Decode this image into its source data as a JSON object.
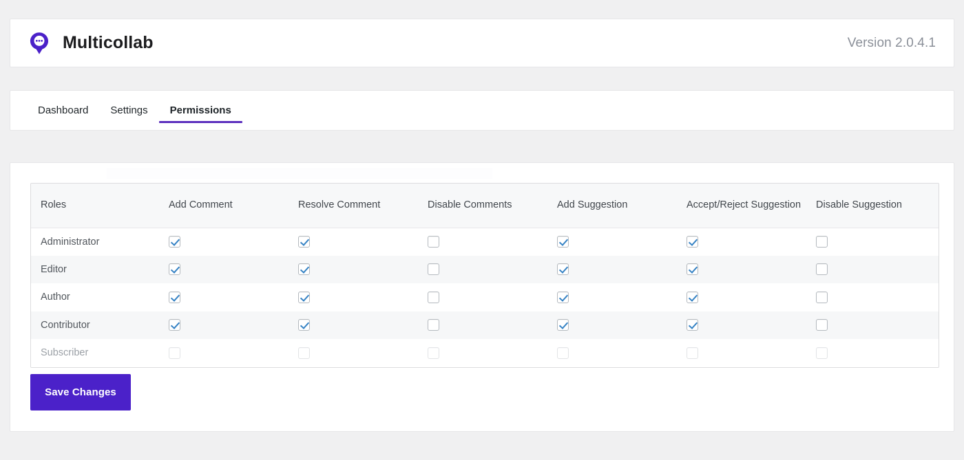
{
  "header": {
    "brand_name": "Multicollab",
    "logo_icon": "speech-bubble-pin-icon",
    "version": "Version 2.0.4.1"
  },
  "colors": {
    "accent": "#5b2ebd",
    "accent_strong": "#4b21c9",
    "logo_purple": "#4b21c9",
    "checkbox_check": "#3582c4",
    "page_background": "#f0f0f1",
    "panel_background": "#ffffff",
    "row_stripe": "#f6f7f8",
    "table_header_background": "#f7f8f9",
    "table_border": "#dcdcde",
    "version_text": "#8a8f98"
  },
  "tabs": [
    {
      "label": "Dashboard",
      "active": false
    },
    {
      "label": "Settings",
      "active": false
    },
    {
      "label": "Permissions",
      "active": true
    }
  ],
  "permissions_table": {
    "columns": [
      "Roles",
      "Add Comment",
      "Resolve Comment",
      "Disable Comments",
      "Add Suggestion",
      "Accept/Reject Suggestion",
      "Disable Suggestion"
    ],
    "rows": [
      {
        "role": "Administrator",
        "disabled": false,
        "values": [
          true,
          true,
          false,
          true,
          true,
          false
        ]
      },
      {
        "role": "Editor",
        "disabled": false,
        "values": [
          true,
          true,
          false,
          true,
          true,
          false
        ]
      },
      {
        "role": "Author",
        "disabled": false,
        "values": [
          true,
          true,
          false,
          true,
          true,
          false
        ]
      },
      {
        "role": "Contributor",
        "disabled": false,
        "values": [
          true,
          true,
          false,
          true,
          true,
          false
        ]
      },
      {
        "role": "Subscriber",
        "disabled": true,
        "values": [
          false,
          false,
          false,
          false,
          false,
          false
        ]
      }
    ]
  },
  "actions": {
    "save_label": "Save Changes"
  }
}
